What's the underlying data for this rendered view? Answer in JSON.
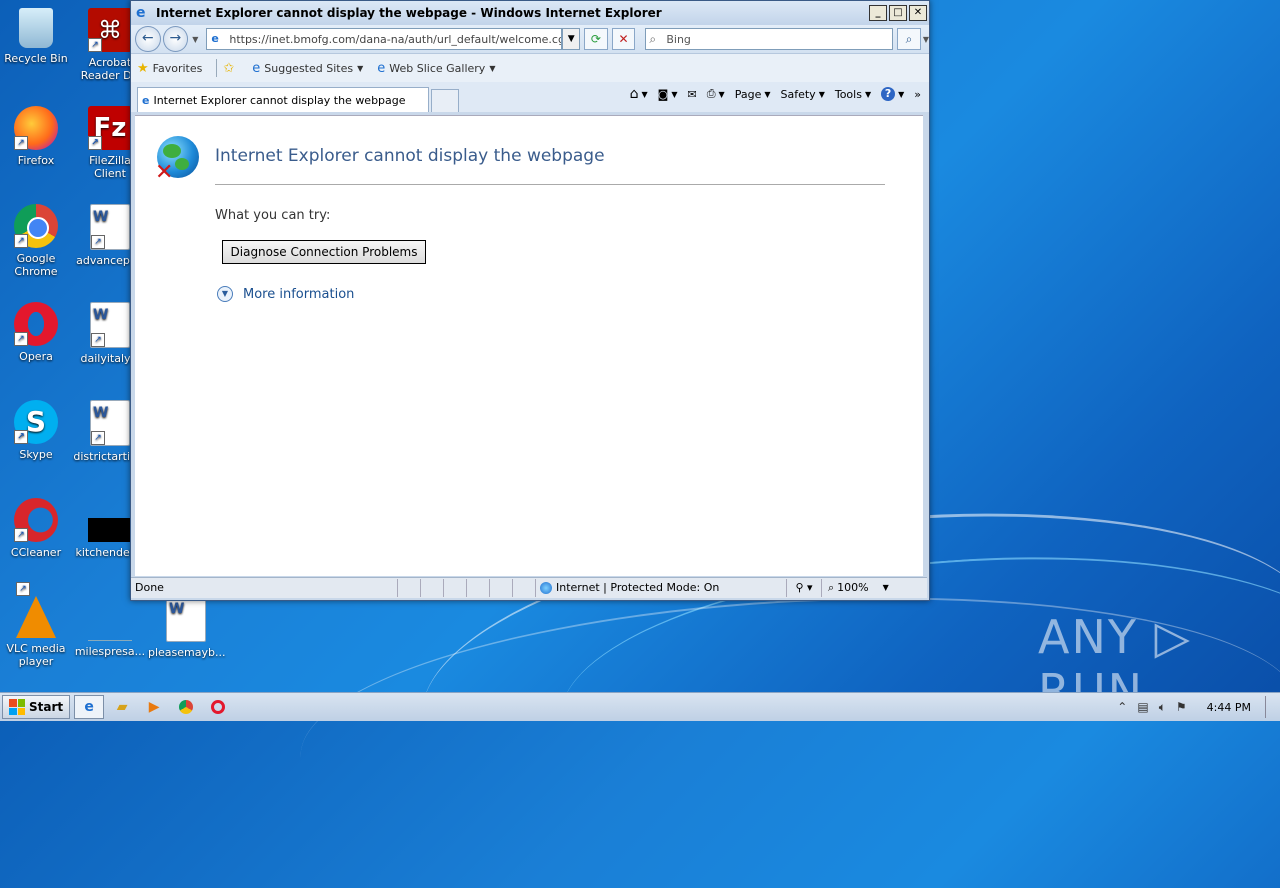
{
  "desktop": {
    "icons": [
      {
        "label": "Recycle Bin"
      },
      {
        "label": "Acrobat Reader DC"
      },
      {
        "label": "Firefox"
      },
      {
        "label": "FileZilla Client"
      },
      {
        "label": "Google Chrome"
      },
      {
        "label": "advancepr..."
      },
      {
        "label": "Opera"
      },
      {
        "label": "dailyitaly..."
      },
      {
        "label": "Skype"
      },
      {
        "label": "districtartic..."
      },
      {
        "label": "CCleaner"
      },
      {
        "label": "kitchendet..."
      },
      {
        "label": "VLC media player"
      },
      {
        "label": "milespresa..."
      },
      {
        "label": "pleasemayb..."
      }
    ],
    "watermark": "ANY ▷ RUN"
  },
  "ie": {
    "window_title": "Internet Explorer cannot display the webpage - Windows Internet Explorer",
    "address": "https://inet.bmofg.com/dana-na/auth/url_default/welcome.cgi",
    "search_placeholder": "Bing",
    "favorites_label": "Favorites",
    "suggested_sites": "Suggested Sites",
    "web_slice_gallery": "Web Slice Gallery",
    "tab_title": "Internet Explorer cannot display the webpage",
    "commands": {
      "page": "Page",
      "safety": "Safety",
      "tools": "Tools"
    },
    "error": {
      "title": "Internet Explorer cannot display the webpage",
      "try_label": "What you can try:",
      "diagnose_button": "Diagnose Connection Problems",
      "more_info": "More information"
    },
    "status": {
      "left": "Done",
      "zone": "Internet | Protected Mode: On",
      "zoom": "100%"
    }
  },
  "taskbar": {
    "start_label": "Start",
    "clock": "4:44 PM"
  }
}
